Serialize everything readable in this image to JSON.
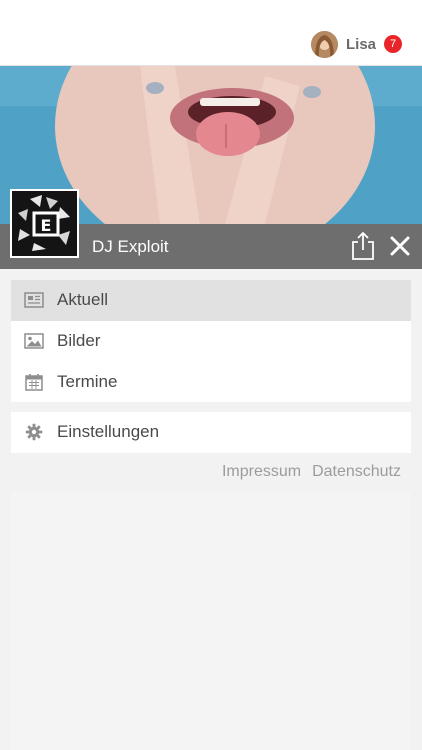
{
  "user": {
    "name": "Lisa",
    "notification_count": "7",
    "avatar_icon": "user-avatar"
  },
  "profile": {
    "name": "DJ Exploit",
    "logo_icon": "dj-exploit-logo",
    "share_icon": "share-icon",
    "close_icon": "close-icon"
  },
  "menu": {
    "items": [
      {
        "label": "Aktuell",
        "icon": "newspaper-icon",
        "active": true
      },
      {
        "label": "Bilder",
        "icon": "image-icon",
        "active": false
      },
      {
        "label": "Termine",
        "icon": "calendar-icon",
        "active": false
      }
    ],
    "settings": {
      "label": "Einstellungen",
      "icon": "gear-icon"
    }
  },
  "footer": {
    "impressum": "Impressum",
    "datenschutz": "Datenschutz"
  },
  "colors": {
    "badge": "#e8262a",
    "profile_bar": "#6e6e6e",
    "active_item": "#e1e1e1",
    "background": "#f2f2f2"
  }
}
